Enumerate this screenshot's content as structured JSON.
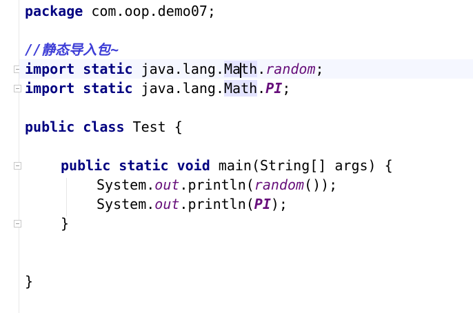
{
  "code": {
    "line1": {
      "keyword": "package",
      "rest": " com.oop.demo07;"
    },
    "line3": {
      "comment": "//静态导入包~"
    },
    "line4": {
      "keyword1": "import",
      "keyword2": "static",
      "pkg": " java.lang.",
      "cls_before_caret": "Ma",
      "cls_after_caret": "th",
      "dot": ".",
      "member": "random",
      "end": ";"
    },
    "line5": {
      "keyword1": "import",
      "keyword2": "static",
      "pkg": " java.lang.",
      "cls": "Math",
      "dot": ".",
      "member": "PI",
      "end": ";"
    },
    "line7": {
      "keyword1": "public",
      "keyword2": "class",
      "rest": " Test {"
    },
    "line9": {
      "keyword1": "public",
      "keyword2": "static",
      "keyword3": "void",
      "rest": " main(String[] args) {"
    },
    "line10": {
      "prefix": "System.",
      "field": "out",
      "call": ".println(",
      "member": "random",
      "end": "());"
    },
    "line11": {
      "prefix": "System.",
      "field": "out",
      "call": ".println(",
      "member": "PI",
      "end": ");"
    },
    "line12": {
      "text": "}"
    },
    "line15": {
      "text": "}"
    }
  },
  "colors": {
    "keyword": "#000080",
    "comment": "#3d3dd6",
    "static_member": "#660e7a"
  }
}
